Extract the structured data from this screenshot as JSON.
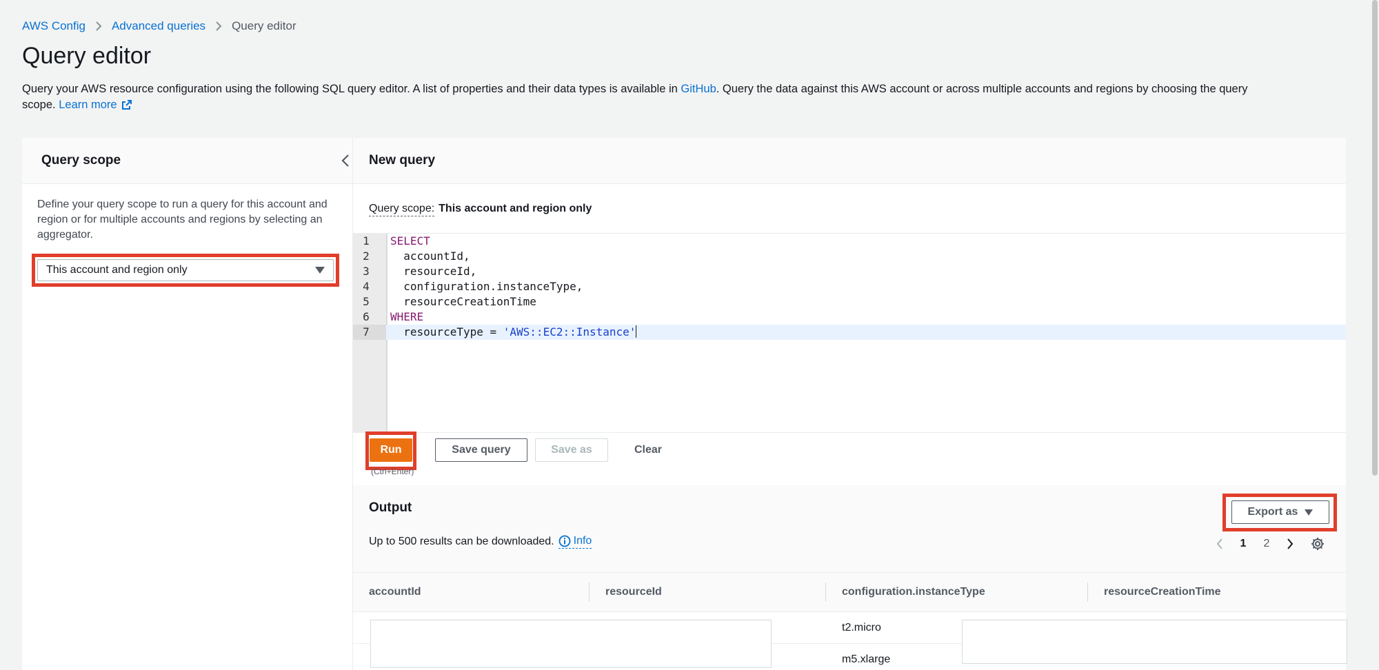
{
  "breadcrumb": {
    "items": [
      "AWS Config",
      "Advanced queries"
    ],
    "current": "Query editor"
  },
  "page": {
    "title": "Query editor",
    "description_prefix": "Query your AWS resource configuration using the following SQL query editor. A list of properties and their data types is available in ",
    "github_link": "GitHub",
    "description_suffix": ". Query the data against this AWS account or across multiple accounts and regions by choosing the query scope.",
    "learn_more": "Learn more"
  },
  "scope_panel": {
    "title": "Query scope",
    "description": "Define your query scope to run a query for this account and region or for multiple accounts and regions by selecting an aggregator.",
    "selected_scope": "This account and region only"
  },
  "query_panel": {
    "title": "New query",
    "scope_label": "Query scope:",
    "scope_value": "This account and region only",
    "code": {
      "line_numbers": [
        "1",
        "2",
        "3",
        "4",
        "5",
        "6",
        "7"
      ],
      "l1": "SELECT",
      "l2": "  accountId,",
      "l3": "  resourceId,",
      "l4": "  configuration.instanceType,",
      "l5": "  resourceCreationTime",
      "l6": "WHERE",
      "l7_prefix": "  resourceType = ",
      "l7_string": "'AWS::EC2::Instance'"
    },
    "buttons": {
      "run": "Run",
      "run_shortcut": "(Ctrl+Enter)",
      "save_query": "Save query",
      "save_as": "Save as",
      "clear": "Clear"
    }
  },
  "output": {
    "title": "Output",
    "export_label": "Export as",
    "download_note": "Up to 500 results can be downloaded.",
    "info_label": "Info",
    "pagination": {
      "pages": [
        "1",
        "2"
      ],
      "current": "1"
    },
    "columns": [
      "accountId",
      "resourceId",
      "configuration.instanceType",
      "resourceCreationTime"
    ],
    "rows": [
      {
        "instanceType": "t2.micro"
      },
      {
        "instanceType": "m5.xlarge"
      }
    ]
  },
  "colors": {
    "link": "#0972d3",
    "primary_button": "#ec7211",
    "highlight_frame": "#e03e2b",
    "keyword": "#871a70",
    "string": "#1a3fc7"
  }
}
